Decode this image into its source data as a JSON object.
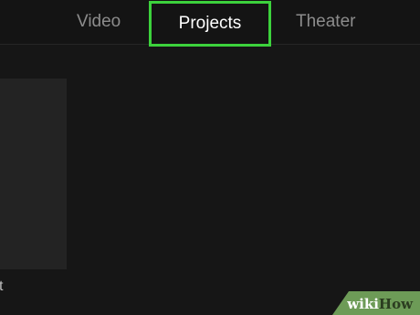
{
  "tabs": {
    "video": "Video",
    "projects": "Projects",
    "theater": "Theater",
    "selected": "Projects",
    "highlight_color": "#3cd23c"
  },
  "projects": [
    {
      "title_fragment": "t"
    }
  ],
  "watermark": {
    "part1": "wiki",
    "part2": "How"
  }
}
